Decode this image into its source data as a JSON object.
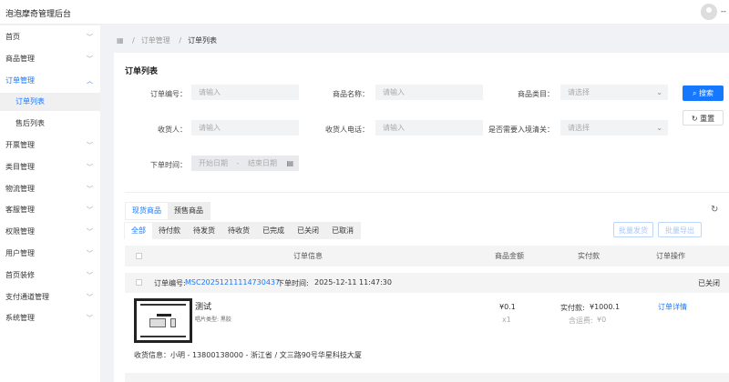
{
  "header": {
    "title": "泡泡摩奇管理后台",
    "user": "--"
  },
  "sidebar": {
    "items": [
      {
        "label": "首页",
        "chev": "v"
      },
      {
        "label": "商品管理",
        "chev": "v"
      },
      {
        "label": "订单管理",
        "chev": "^"
      },
      {
        "label": "订单列表"
      },
      {
        "label": "售后列表"
      },
      {
        "label": "开票管理",
        "chev": "v"
      },
      {
        "label": "类目管理",
        "chev": "v"
      },
      {
        "label": "物流管理",
        "chev": "v"
      },
      {
        "label": "客服管理",
        "chev": "v"
      },
      {
        "label": "权限管理",
        "chev": "v"
      },
      {
        "label": "用户管理",
        "chev": "v"
      },
      {
        "label": "首页装修",
        "chev": "v"
      },
      {
        "label": "支付通道管理",
        "chev": "v"
      },
      {
        "label": "系统管理",
        "chev": "v"
      }
    ]
  },
  "breadcrumb": {
    "home_icon": "grid-icon",
    "items": [
      "订单管理",
      "订单列表"
    ]
  },
  "page_title": "订单列表",
  "form": {
    "order_no": {
      "label": "订单编号：",
      "placeholder": "请输入"
    },
    "product_name": {
      "label": "商品名称：",
      "placeholder": "请输入"
    },
    "category": {
      "label": "商品类目：",
      "placeholder": "请选择"
    },
    "receiver": {
      "label": "收货人：",
      "placeholder": "请输入"
    },
    "receiver_phone": {
      "label": "收货人电话：",
      "placeholder": "请输入"
    },
    "customs": {
      "label": "是否需要入境清关：",
      "placeholder": "请选择"
    },
    "order_time": {
      "label": "下单时间：",
      "start": "开始日期",
      "sep": "-",
      "end": "结束日期"
    },
    "search": "搜索",
    "reset": "重置"
  },
  "goods_tabs": [
    "现货商品",
    "预售商品"
  ],
  "status_tabs": [
    "全部",
    "待付款",
    "待发货",
    "待收货",
    "已完成",
    "已关闭",
    "已取消"
  ],
  "batch": {
    "ship": "批量发货",
    "export": "批量导出"
  },
  "table": {
    "headers": [
      "订单信息",
      "商品金额",
      "实付款",
      "订单操作"
    ]
  },
  "orders": [
    {
      "no_label": "订单编号:",
      "no": "MSC20251211114730437",
      "time_label": "下单时间:",
      "time": "2025-12-11 11:47:30",
      "status": "已关闭",
      "product": {
        "name": "测试",
        "spec": "唱片类型: 黑胶",
        "price": "¥0.1",
        "qty": "x1"
      },
      "paid_label": "实付款:",
      "paid": "¥1000.1",
      "shipping_label": "含运费:",
      "shipping": "¥0",
      "action": "订单详情",
      "address": "收货信息：小明 - 13800138000 - 浙江省 / 文三路90号华星科技大厦"
    }
  ],
  "colors": {
    "primary": "#1677ff"
  }
}
